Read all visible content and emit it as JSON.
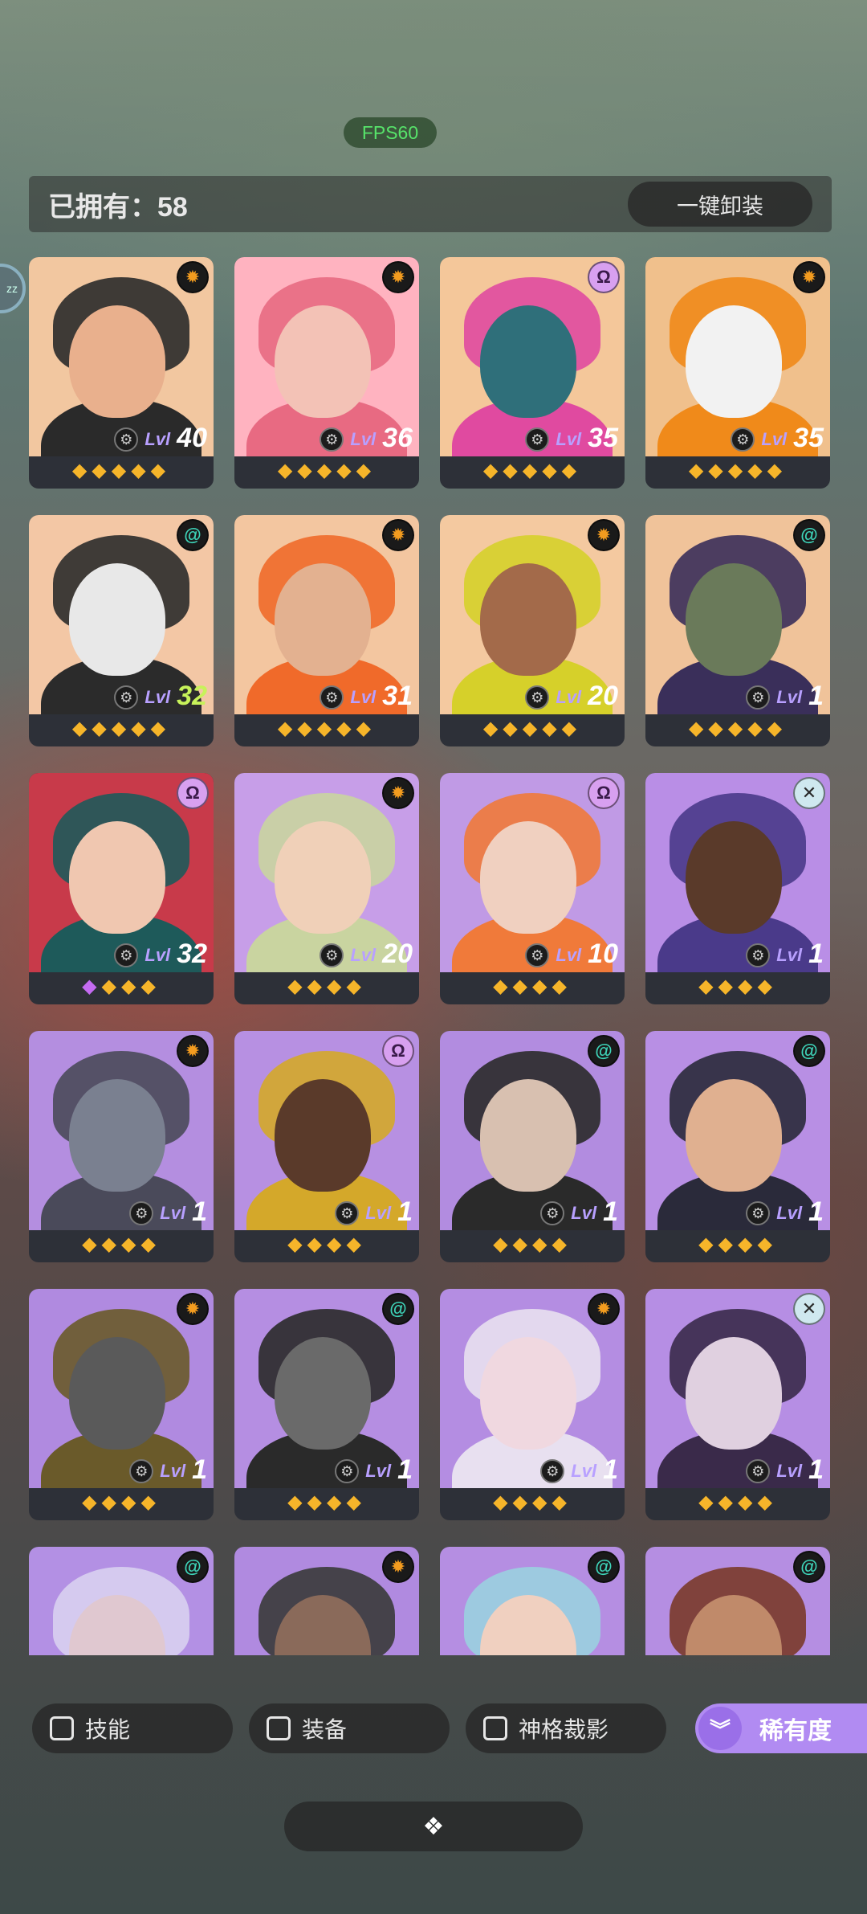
{
  "status": {
    "fps": "FPS60"
  },
  "header": {
    "owned_label": "已拥有：58",
    "unequip_label": "一键卸装"
  },
  "side_tab": {
    "text": "zz"
  },
  "cards": [
    {
      "faction": "sun",
      "level": "40",
      "stars": 5,
      "bg": "#f2c7a0",
      "accent": "#2a2a2a",
      "skin": "#e9b08d"
    },
    {
      "faction": "sun",
      "level": "36",
      "stars": 5,
      "bg": "#ffb3c0",
      "accent": "#e86a82",
      "skin": "#f3c2b6"
    },
    {
      "faction": "omega",
      "level": "35",
      "stars": 5,
      "bg": "#f4c79a",
      "accent": "#e04aa0",
      "skin": "#2f6f7a"
    },
    {
      "faction": "sun",
      "level": "35",
      "stars": 5,
      "bg": "#f0c08c",
      "accent": "#f08a1a",
      "skin": "#f2f2f2"
    },
    {
      "faction": "spiral",
      "level": "32",
      "stars": 5,
      "bg": "#f3c7a5",
      "accent": "#2b2b2b",
      "skin": "#e8e8e8",
      "green": true
    },
    {
      "faction": "sun",
      "level": "31",
      "stars": 5,
      "bg": "#f3c6a0",
      "accent": "#f06a2a",
      "skin": "#e3b190"
    },
    {
      "faction": "sun",
      "level": "20",
      "stars": 5,
      "bg": "#f4c9a0",
      "accent": "#d6d02a",
      "skin": "#a36a4a"
    },
    {
      "faction": "spiral",
      "level": "1",
      "stars": 5,
      "bg": "#f0c39a",
      "accent": "#3a2f5a",
      "skin": "#6a7a5a"
    },
    {
      "faction": "omega",
      "level": "32",
      "stars": 4,
      "bg": "#c83a4a",
      "accent": "#1e5a5a",
      "skin": "#f0c7b0",
      "purple_first": true
    },
    {
      "faction": "sun",
      "level": "20",
      "stars": 4,
      "bg": "#c79ee8",
      "accent": "#c9d4a0",
      "skin": "#f0d0b8"
    },
    {
      "faction": "omega",
      "level": "10",
      "stars": 4,
      "bg": "#c09ae5",
      "accent": "#f07a3a",
      "skin": "#f0d0c0"
    },
    {
      "faction": "x",
      "level": "1",
      "stars": 4,
      "bg": "#b98ee6",
      "accent": "#4a3a8a",
      "skin": "#5a3a2a"
    },
    {
      "faction": "sun",
      "level": "1",
      "stars": 4,
      "bg": "#b48ee0",
      "accent": "#4a4a5a",
      "skin": "#7a8090"
    },
    {
      "faction": "omega",
      "level": "1",
      "stars": 4,
      "bg": "#b790e2",
      "accent": "#d4a82a",
      "skin": "#5a3a2a"
    },
    {
      "faction": "spiral",
      "level": "1",
      "stars": 4,
      "bg": "#b28ce0",
      "accent": "#2a2a2a",
      "skin": "#d8c0b0"
    },
    {
      "faction": "spiral",
      "level": "1",
      "stars": 4,
      "bg": "#b88fe4",
      "accent": "#2a2a3a",
      "skin": "#e0b090"
    },
    {
      "faction": "sun",
      "level": "1",
      "stars": 4,
      "bg": "#b08ae0",
      "accent": "#6a5a2a",
      "skin": "#5a5a5a"
    },
    {
      "faction": "spiral",
      "level": "1",
      "stars": 4,
      "bg": "#b58ee2",
      "accent": "#2a2a2a",
      "skin": "#6a6a6a"
    },
    {
      "faction": "sun",
      "level": "1",
      "stars": 4,
      "bg": "#b48de2",
      "accent": "#e8e0f0",
      "skin": "#f0d8e0"
    },
    {
      "faction": "x",
      "level": "1",
      "stars": 4,
      "bg": "#b68ee4",
      "accent": "#3a2a4a",
      "skin": "#e0d0e0"
    },
    {
      "faction": "spiral",
      "level": "",
      "stars": 0,
      "bg": "#b390e4",
      "accent": "#d8d0f0",
      "skin": "#e0c8d0"
    },
    {
      "faction": "sun",
      "level": "",
      "stars": 0,
      "bg": "#b08ae0",
      "accent": "#3a3a3a",
      "skin": "#8a6a5a"
    },
    {
      "faction": "spiral",
      "level": "",
      "stars": 0,
      "bg": "#b58ee2",
      "accent": "#9ad0e0",
      "skin": "#f0d0c0"
    },
    {
      "faction": "spiral",
      "level": "",
      "stars": 0,
      "bg": "#b58ee2",
      "accent": "#7a3a2a",
      "skin": "#c08a6a"
    }
  ],
  "card_labels": {
    "level_prefix": "Lvl"
  },
  "filters": [
    {
      "label": "技能"
    },
    {
      "label": "装备"
    },
    {
      "label": "神格裁影"
    }
  ],
  "rarity_label": "稀有度",
  "icons": {
    "faction_sun": "sun-emblem-icon",
    "faction_omega": "omega-emblem-icon",
    "faction_spiral": "spiral-emblem-icon",
    "faction_x": "cross-emblem-icon",
    "weapon": "weapon-slot-icon",
    "rarity": "double-chevron-down-icon",
    "bottom": "expand-diamonds-icon"
  }
}
